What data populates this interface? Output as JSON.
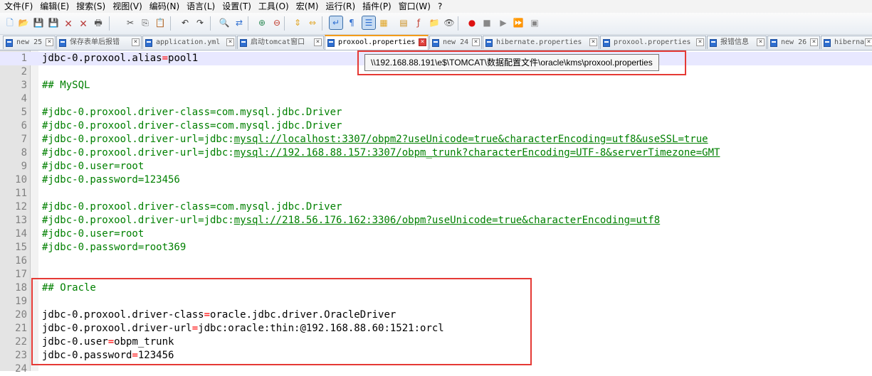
{
  "menu": [
    "文件(F)",
    "编辑(E)",
    "搜索(S)",
    "视图(V)",
    "编码(N)",
    "语言(L)",
    "设置(T)",
    "工具(O)",
    "宏(M)",
    "运行(R)",
    "插件(P)",
    "窗口(W)",
    "?"
  ],
  "toolbar": {
    "buttons": [
      {
        "name": "new-file-icon",
        "glyph": "🗋",
        "color": "#4a90d9"
      },
      {
        "name": "open-file-icon",
        "glyph": "📂",
        "color": "#e0a526"
      },
      {
        "name": "save-icon",
        "glyph": "💾",
        "color": "#3b6ea8"
      },
      {
        "name": "save-all-icon",
        "glyph": "💾",
        "color": "#3b6ea8"
      },
      {
        "name": "close-file-icon",
        "glyph": "🗙",
        "color": "#b44"
      },
      {
        "name": "close-all-icon",
        "glyph": "🗙",
        "color": "#b44"
      },
      {
        "name": "print-icon",
        "glyph": "🖶",
        "color": "#555"
      },
      {
        "name": "cut-icon",
        "glyph": "✂",
        "color": "#555"
      },
      {
        "name": "copy-icon",
        "glyph": "⎘",
        "color": "#555"
      },
      {
        "name": "paste-icon",
        "glyph": "📋",
        "color": "#8a6d3b"
      },
      {
        "name": "undo-icon",
        "glyph": "↶",
        "color": "#333"
      },
      {
        "name": "redo-icon",
        "glyph": "↷",
        "color": "#333"
      },
      {
        "name": "find-icon",
        "glyph": "🔍",
        "color": "#333"
      },
      {
        "name": "replace-icon",
        "glyph": "⇄",
        "color": "#2f6fd1"
      },
      {
        "name": "zoom-in-icon",
        "glyph": "⊕",
        "color": "#2e8b57"
      },
      {
        "name": "zoom-out-icon",
        "glyph": "⊖",
        "color": "#c0392b"
      },
      {
        "name": "sync-vertical-icon",
        "glyph": "⇕",
        "color": "#e0a526"
      },
      {
        "name": "sync-horizontal-icon",
        "glyph": "⇔",
        "color": "#e0a526"
      },
      {
        "name": "word-wrap-icon",
        "glyph": "↵",
        "color": "#2f6fd1"
      },
      {
        "name": "show-all-chars-icon",
        "glyph": "¶",
        "color": "#2f6fd1"
      },
      {
        "name": "indent-guide-icon",
        "glyph": "☰",
        "color": "#2f6fd1"
      },
      {
        "name": "udl-icon",
        "glyph": "▦",
        "color": "#e0a526"
      },
      {
        "name": "doc-map-icon",
        "glyph": "▤",
        "color": "#c98b1a"
      },
      {
        "name": "function-list-icon",
        "glyph": "ƒ",
        "color": "#c0392b"
      },
      {
        "name": "folder-workspace-icon",
        "glyph": "📁",
        "color": "#e0a526"
      },
      {
        "name": "monitoring-icon",
        "glyph": "👁",
        "color": "#555"
      },
      {
        "name": "record-macro-icon",
        "glyph": "●",
        "color": "#d11"
      },
      {
        "name": "stop-record-icon",
        "glyph": "■",
        "color": "#888"
      },
      {
        "name": "playback-icon",
        "glyph": "▶",
        "color": "#888"
      },
      {
        "name": "run-macro-multiple-icon",
        "glyph": "⏩",
        "color": "#2f6fd1"
      },
      {
        "name": "save-macro-icon",
        "glyph": "▣",
        "color": "#888"
      }
    ]
  },
  "tabs": [
    {
      "label": "new 25",
      "active": false
    },
    {
      "label": "保存表单后报错",
      "active": false
    },
    {
      "label": "application.yml",
      "active": false
    },
    {
      "label": "启动tomcat窗口",
      "active": false
    },
    {
      "label": "proxool.properties",
      "active": true
    },
    {
      "label": "new 24",
      "active": false
    },
    {
      "label": "hibernate.properties",
      "active": false
    },
    {
      "label": "proxool.properties",
      "active": false
    },
    {
      "label": "报错信息",
      "active": false
    },
    {
      "label": "new 26",
      "active": false
    },
    {
      "label": "hibernate",
      "active": false
    }
  ],
  "tooltip": "\\\\192.168.88.191\\e$\\TOMCAT\\数据配置文件\\oracle\\kms\\proxool.properties",
  "editor": {
    "lines": [
      {
        "n": "1",
        "kind": "prop",
        "key": "jdbc-0.proxool.alias",
        "value": "pool1"
      },
      {
        "n": "2",
        "kind": "blank"
      },
      {
        "n": "3",
        "kind": "comment",
        "text": "## MySQL"
      },
      {
        "n": "4",
        "kind": "blank"
      },
      {
        "n": "5",
        "kind": "comment",
        "text": "#jdbc-0.proxool.driver-class=com.mysql.jdbc.Driver"
      },
      {
        "n": "6",
        "kind": "comment",
        "text": "#jdbc-0.proxool.driver-class=com.mysql.jdbc.Driver"
      },
      {
        "n": "7",
        "kind": "comment",
        "text": "#jdbc-0.proxool.driver-url=jdbc:",
        "link": "mysql://localhost:3307/obpm2?useUnicode=true&characterEncoding=utf8&useSSL=true"
      },
      {
        "n": "8",
        "kind": "comment",
        "text": "#jdbc-0.proxool.driver-url=jdbc:",
        "link": "mysql://192.168.88.157:3307/obpm_trunk?characterEncoding=UTF-8&serverTimezone=GMT"
      },
      {
        "n": "9",
        "kind": "comment",
        "text": "#jdbc-0.user=root"
      },
      {
        "n": "10",
        "kind": "comment",
        "text": "#jdbc-0.password=123456"
      },
      {
        "n": "11",
        "kind": "blank"
      },
      {
        "n": "12",
        "kind": "comment",
        "text": "#jdbc-0.proxool.driver-class=com.mysql.jdbc.Driver"
      },
      {
        "n": "13",
        "kind": "comment",
        "text": "#jdbc-0.proxool.driver-url=jdbc:",
        "link": "mysql://218.56.176.162:3306/obpm?useUnicode=true&characterEncoding=utf8"
      },
      {
        "n": "14",
        "kind": "comment",
        "text": "#jdbc-0.user=root"
      },
      {
        "n": "15",
        "kind": "comment",
        "text": "#jdbc-0.password=root369"
      },
      {
        "n": "16",
        "kind": "blank"
      },
      {
        "n": "17",
        "kind": "blank"
      },
      {
        "n": "18",
        "kind": "comment",
        "text": "## Oracle"
      },
      {
        "n": "19",
        "kind": "blank"
      },
      {
        "n": "20",
        "kind": "prop",
        "key": "jdbc-0.proxool.driver-class",
        "value": "oracle.jdbc.driver.OracleDriver"
      },
      {
        "n": "21",
        "kind": "prop",
        "key": "jdbc-0.proxool.driver-url",
        "value": "jdbc:oracle:thin:@192.168.88.60:1521:orcl"
      },
      {
        "n": "22",
        "kind": "prop",
        "key": "jdbc-0.user",
        "value": "obpm_trunk"
      },
      {
        "n": "23",
        "kind": "prop",
        "key": "jdbc-0.password",
        "value": "123456"
      },
      {
        "n": "24",
        "kind": "blank"
      }
    ]
  },
  "colors": {
    "comment": "#008000",
    "operator": "#ff0000",
    "current_line": "#e8e8ff",
    "active_tab_accent": "#f39c1a",
    "annotation_box": "#e53935"
  }
}
